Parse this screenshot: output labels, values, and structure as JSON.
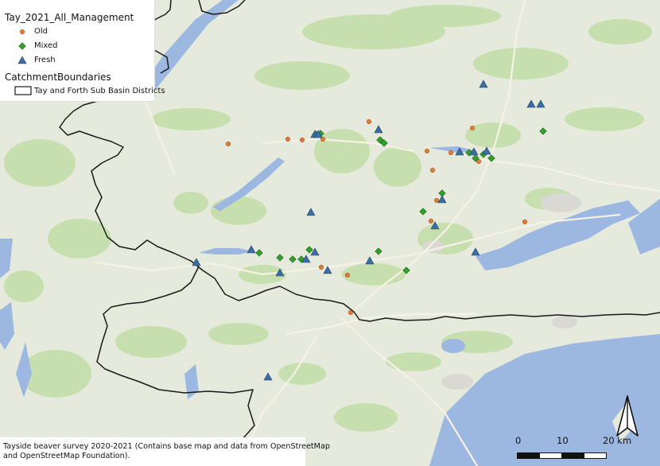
{
  "legend": {
    "layer_title": "Tay_2021_All_Management",
    "items": [
      {
        "label": "Old",
        "symbol": "orange-circle",
        "color": "#e07b39"
      },
      {
        "label": "Mixed",
        "symbol": "green-diamond",
        "color": "#33a02c"
      },
      {
        "label": "Fresh",
        "symbol": "blue-triangle",
        "color": "#3b6ea5"
      }
    ],
    "boundary_title": "CatchmentBoundaries",
    "boundary_label": "Tay and Forth Sub Basin Districts"
  },
  "credit": {
    "line1": "Tayside beaver survey 2020-2021 (Contains base map and data from OpenStreetMap",
    "line2": "and OpenStreetMap Foundation)."
  },
  "scale_bar": {
    "labels": [
      "0",
      "10",
      "20 km"
    ]
  },
  "colors": {
    "land": "#e6eadc",
    "forest": "#c7dfae",
    "water": "#9db8e0",
    "road": "#f7f2e6",
    "boundary": "#1a1a1a"
  },
  "icons": {
    "north_arrow": "north-arrow-icon"
  }
}
